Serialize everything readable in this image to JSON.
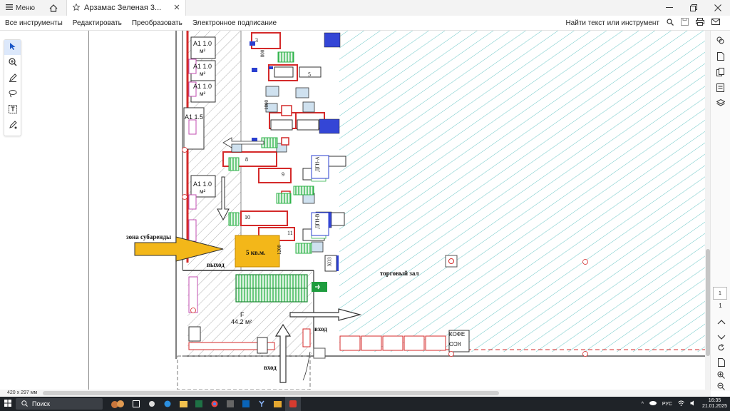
{
  "titlebar": {
    "menu_label": "Меню",
    "tab_title": "Арзамас Зеленая 3...",
    "colors": {
      "bg": "#f3f3f3"
    }
  },
  "toolbar": {
    "all_tools": "Все инструменты",
    "edit": "Редактировать",
    "convert": "Преобразовать",
    "esign": "Электронное подписание",
    "find": "Найти текст или инструмент"
  },
  "plan": {
    "labels": {
      "a1_1": "А1 1.0",
      "a1_2": "А1 1.0",
      "a1_3": "А1 1.0",
      "a1_15": "А1 1.5",
      "a1_4": "А1 1.0",
      "m2": "м²",
      "sublease_zone": "зона субаренды",
      "five_sqm": "5 кв.м.",
      "exit": "выход",
      "sales_hall": "торговый зал",
      "entrance_right": "вход",
      "entrance_bottom": "вход",
      "f_area": "F",
      "f_size": "44.2 м²",
      "coffee": "КОФЕ",
      "kso": "КСО",
      "dim_800": "800",
      "dim_1800": "1800",
      "dim_1200": "1200",
      "num_3": "3",
      "num_5": "5",
      "num_8": "8",
      "num_9": "9",
      "num_10": "10",
      "num_11": "11",
      "dgn_a": "ДГН-А",
      "dgn_v": "ДГН-В",
      "hoz": "ХОЗ"
    },
    "colors": {
      "hatch": "#6bc7c7",
      "wall": "#d42a2a",
      "yellow": "#f3b719",
      "green": "#2fb34a",
      "blue": "#2a3fd0"
    }
  },
  "status": {
    "page_size": "420 x 297 мм"
  },
  "rightrail": {
    "page_box": "1",
    "current_page": "1"
  },
  "taskbar": {
    "search": "Поиск",
    "lang": "РУС",
    "time": "16:35",
    "date": "21.01.2025"
  }
}
